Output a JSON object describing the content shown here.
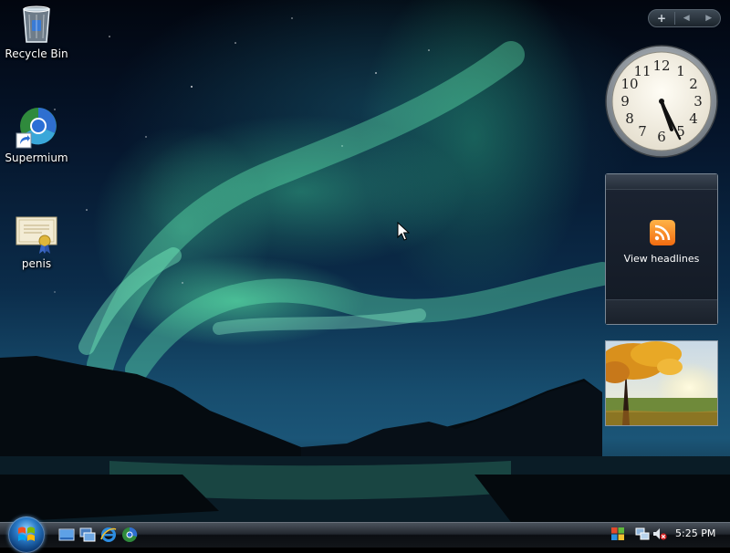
{
  "desktop": {
    "icons": [
      {
        "label": "Recycle Bin",
        "icon": "recycle-bin-icon"
      },
      {
        "label": "Supermium",
        "icon": "supermium-browser-icon"
      },
      {
        "label": "penis",
        "icon": "certificate-file-icon"
      }
    ]
  },
  "sidebar": {
    "controls": {
      "add": "+",
      "prev": "◀",
      "next": "▶"
    },
    "feed_gadget": {
      "label": "View headlines",
      "icon": "rss-icon"
    },
    "clock_gadget": {
      "numerals": [
        "12",
        "1",
        "2",
        "3",
        "4",
        "5",
        "6",
        "7",
        "8",
        "9",
        "10",
        "11"
      ]
    }
  },
  "taskbar": {
    "start_icon": "windows-logo-icon",
    "quick_launch": [
      "show-desktop-icon",
      "switch-windows-icon",
      "internet-explorer-icon",
      "supermium-icon"
    ],
    "tray": {
      "icons": [
        "windows-update-shield-icon",
        "network-icon",
        "volume-muted-icon"
      ],
      "time": "5:25 PM"
    }
  },
  "colors": {
    "aurora": "#5ef0a8",
    "sky": "#0b2c4a",
    "taskbar": "#121519",
    "rss": "#f26b10"
  }
}
